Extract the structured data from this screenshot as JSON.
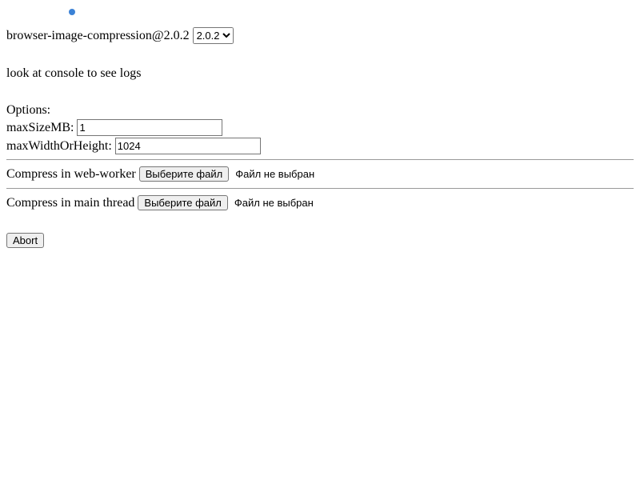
{
  "header": {
    "title": "browser-image-compression@2.0.2",
    "version_selected": "2.0.2"
  },
  "log_line": "look at console to see logs",
  "options": {
    "title": "Options:",
    "maxSizeMB": {
      "label": "maxSizeMB:",
      "value": "1"
    },
    "maxWidthOrHeight": {
      "label": "maxWidthOrHeight:",
      "value": "1024"
    }
  },
  "compress": {
    "web_worker_label": "Compress in web-worker",
    "main_thread_label": "Compress in main thread",
    "file_button": "Выберите файл",
    "file_status": "Файл не выбран"
  },
  "abort": {
    "label": "Abort"
  }
}
